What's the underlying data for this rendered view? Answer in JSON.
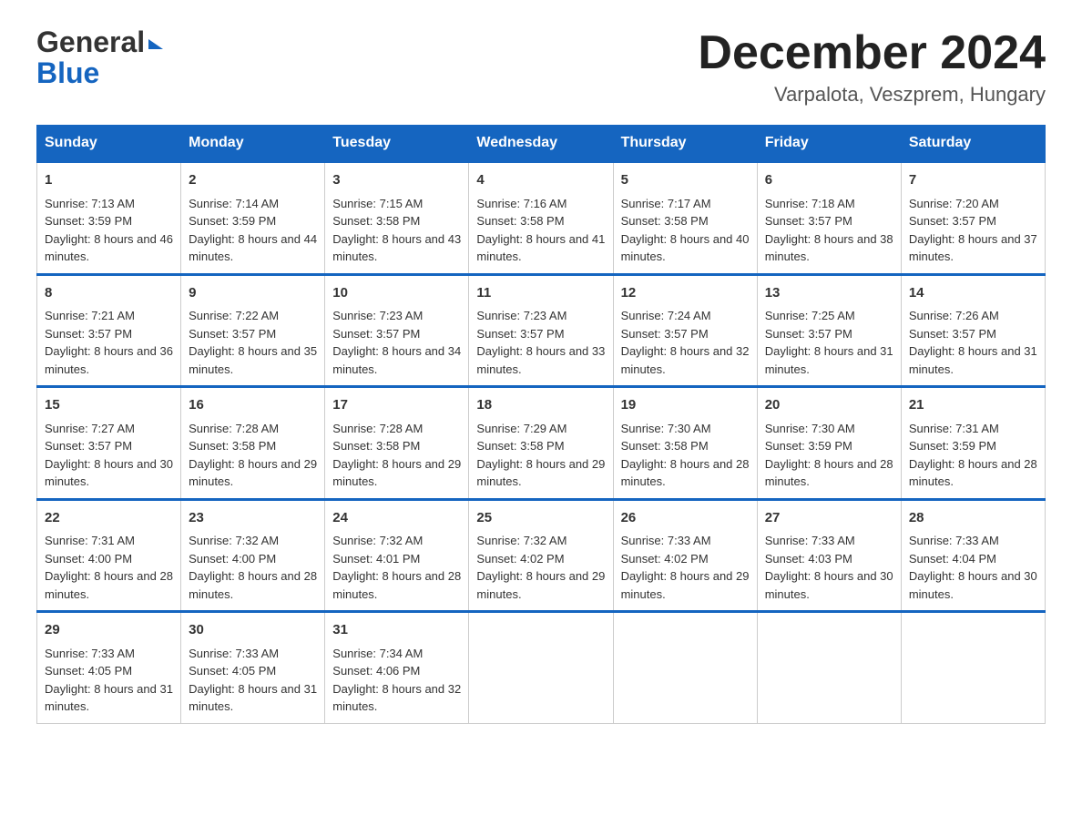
{
  "header": {
    "logo_general": "General",
    "logo_blue": "Blue",
    "month_title": "December 2024",
    "location": "Varpalota, Veszprem, Hungary"
  },
  "weekdays": [
    "Sunday",
    "Monday",
    "Tuesday",
    "Wednesday",
    "Thursday",
    "Friday",
    "Saturday"
  ],
  "weeks": [
    [
      {
        "day": "1",
        "sunrise": "7:13 AM",
        "sunset": "3:59 PM",
        "daylight": "8 hours and 46 minutes."
      },
      {
        "day": "2",
        "sunrise": "7:14 AM",
        "sunset": "3:59 PM",
        "daylight": "8 hours and 44 minutes."
      },
      {
        "day": "3",
        "sunrise": "7:15 AM",
        "sunset": "3:58 PM",
        "daylight": "8 hours and 43 minutes."
      },
      {
        "day": "4",
        "sunrise": "7:16 AM",
        "sunset": "3:58 PM",
        "daylight": "8 hours and 41 minutes."
      },
      {
        "day": "5",
        "sunrise": "7:17 AM",
        "sunset": "3:58 PM",
        "daylight": "8 hours and 40 minutes."
      },
      {
        "day": "6",
        "sunrise": "7:18 AM",
        "sunset": "3:57 PM",
        "daylight": "8 hours and 38 minutes."
      },
      {
        "day": "7",
        "sunrise": "7:20 AM",
        "sunset": "3:57 PM",
        "daylight": "8 hours and 37 minutes."
      }
    ],
    [
      {
        "day": "8",
        "sunrise": "7:21 AM",
        "sunset": "3:57 PM",
        "daylight": "8 hours and 36 minutes."
      },
      {
        "day": "9",
        "sunrise": "7:22 AM",
        "sunset": "3:57 PM",
        "daylight": "8 hours and 35 minutes."
      },
      {
        "day": "10",
        "sunrise": "7:23 AM",
        "sunset": "3:57 PM",
        "daylight": "8 hours and 34 minutes."
      },
      {
        "day": "11",
        "sunrise": "7:23 AM",
        "sunset": "3:57 PM",
        "daylight": "8 hours and 33 minutes."
      },
      {
        "day": "12",
        "sunrise": "7:24 AM",
        "sunset": "3:57 PM",
        "daylight": "8 hours and 32 minutes."
      },
      {
        "day": "13",
        "sunrise": "7:25 AM",
        "sunset": "3:57 PM",
        "daylight": "8 hours and 31 minutes."
      },
      {
        "day": "14",
        "sunrise": "7:26 AM",
        "sunset": "3:57 PM",
        "daylight": "8 hours and 31 minutes."
      }
    ],
    [
      {
        "day": "15",
        "sunrise": "7:27 AM",
        "sunset": "3:57 PM",
        "daylight": "8 hours and 30 minutes."
      },
      {
        "day": "16",
        "sunrise": "7:28 AM",
        "sunset": "3:58 PM",
        "daylight": "8 hours and 29 minutes."
      },
      {
        "day": "17",
        "sunrise": "7:28 AM",
        "sunset": "3:58 PM",
        "daylight": "8 hours and 29 minutes."
      },
      {
        "day": "18",
        "sunrise": "7:29 AM",
        "sunset": "3:58 PM",
        "daylight": "8 hours and 29 minutes."
      },
      {
        "day": "19",
        "sunrise": "7:30 AM",
        "sunset": "3:58 PM",
        "daylight": "8 hours and 28 minutes."
      },
      {
        "day": "20",
        "sunrise": "7:30 AM",
        "sunset": "3:59 PM",
        "daylight": "8 hours and 28 minutes."
      },
      {
        "day": "21",
        "sunrise": "7:31 AM",
        "sunset": "3:59 PM",
        "daylight": "8 hours and 28 minutes."
      }
    ],
    [
      {
        "day": "22",
        "sunrise": "7:31 AM",
        "sunset": "4:00 PM",
        "daylight": "8 hours and 28 minutes."
      },
      {
        "day": "23",
        "sunrise": "7:32 AM",
        "sunset": "4:00 PM",
        "daylight": "8 hours and 28 minutes."
      },
      {
        "day": "24",
        "sunrise": "7:32 AM",
        "sunset": "4:01 PM",
        "daylight": "8 hours and 28 minutes."
      },
      {
        "day": "25",
        "sunrise": "7:32 AM",
        "sunset": "4:02 PM",
        "daylight": "8 hours and 29 minutes."
      },
      {
        "day": "26",
        "sunrise": "7:33 AM",
        "sunset": "4:02 PM",
        "daylight": "8 hours and 29 minutes."
      },
      {
        "day": "27",
        "sunrise": "7:33 AM",
        "sunset": "4:03 PM",
        "daylight": "8 hours and 30 minutes."
      },
      {
        "day": "28",
        "sunrise": "7:33 AM",
        "sunset": "4:04 PM",
        "daylight": "8 hours and 30 minutes."
      }
    ],
    [
      {
        "day": "29",
        "sunrise": "7:33 AM",
        "sunset": "4:05 PM",
        "daylight": "8 hours and 31 minutes."
      },
      {
        "day": "30",
        "sunrise": "7:33 AM",
        "sunset": "4:05 PM",
        "daylight": "8 hours and 31 minutes."
      },
      {
        "day": "31",
        "sunrise": "7:34 AM",
        "sunset": "4:06 PM",
        "daylight": "8 hours and 32 minutes."
      },
      null,
      null,
      null,
      null
    ]
  ],
  "sunrise_label": "Sunrise:",
  "sunset_label": "Sunset:",
  "daylight_label": "Daylight:"
}
